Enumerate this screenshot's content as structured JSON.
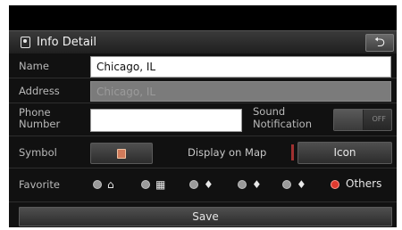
{
  "header": {
    "title": "Info Detail",
    "back_glyph": "⮌",
    "title_icon": "info-pin-icon",
    "back_icon": "back-arrow-icon"
  },
  "fields": {
    "name_label": "Name",
    "name_value": "Chicago, IL",
    "address_label": "Address",
    "address_value": "Chicago, IL",
    "phone_label_line1": "Phone",
    "phone_label_line2": "Number",
    "phone_value": "",
    "sound_label_line1": "Sound",
    "sound_label_line2": "Notification",
    "sound_toggle": "OFF"
  },
  "symbol": {
    "label": "Symbol",
    "display_label": "Display on Map",
    "display_value": "Icon",
    "symbol_icon": "poi-marker-icon"
  },
  "favorite": {
    "label": "Favorite",
    "options": [
      {
        "icon": "home-icon",
        "glyph": "⌂",
        "selected": false
      },
      {
        "icon": "office-building-icon",
        "glyph": "▦",
        "selected": false
      },
      {
        "icon": "favorite-1-icon",
        "glyph": "♦",
        "selected": false
      },
      {
        "icon": "favorite-2-icon",
        "glyph": "♦",
        "selected": false
      },
      {
        "icon": "favorite-3-icon",
        "glyph": "♦",
        "selected": false
      },
      {
        "icon": "others-icon",
        "glyph": "",
        "label": "Others",
        "selected": true
      }
    ]
  },
  "footer": {
    "save_label": "Save"
  },
  "colors": {
    "accent_red": "#e03a2f",
    "field_bg": "#ffffff",
    "panel_bg": "#111111"
  }
}
